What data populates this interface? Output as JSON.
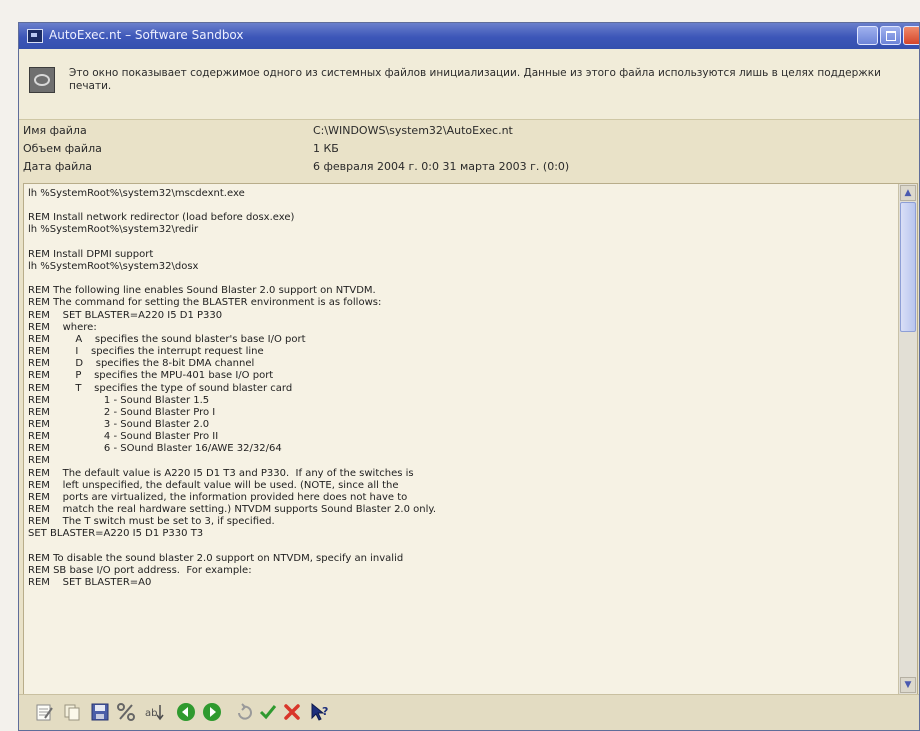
{
  "window": {
    "title": "AutoExec.nt – Software Sandbox"
  },
  "info": {
    "description": "Это окно показывает содержимое одного из системных файлов инициализации. Данные из этого файла используются лишь в целях поддержки печати."
  },
  "properties": [
    {
      "name": "Имя файла",
      "value": "C:\\WINDOWS\\system32\\AutoExec.nt"
    },
    {
      "name": "Объем файла",
      "value": "1 КБ"
    },
    {
      "name": "Дата файла",
      "value": "6 февраля 2004 г. 0:0 31 марта 2003 г. (0:0)"
    }
  ],
  "content": {
    "text": "lh %SystemRoot%\\system32\\mscdexnt.exe\n\nREM Install network redirector (load before dosx.exe)\nlh %SystemRoot%\\system32\\redir\n\nREM Install DPMI support\nlh %SystemRoot%\\system32\\dosx\n\nREM The following line enables Sound Blaster 2.0 support on NTVDM.\nREM The command for setting the BLASTER environment is as follows:\nREM    SET BLASTER=A220 I5 D1 P330\nREM    where:\nREM        A    specifies the sound blaster's base I/O port\nREM        I    specifies the interrupt request line\nREM        D    specifies the 8-bit DMA channel\nREM        P    specifies the MPU-401 base I/O port\nREM        T    specifies the type of sound blaster card\nREM                 1 - Sound Blaster 1.5\nREM                 2 - Sound Blaster Pro I\nREM                 3 - Sound Blaster 2.0\nREM                 4 - Sound Blaster Pro II\nREM                 6 - SOund Blaster 16/AWE 32/32/64\nREM\nREM    The default value is A220 I5 D1 T3 and P330.  If any of the switches is\nREM    left unspecified, the default value will be used. (NOTE, since all the\nREM    ports are virtualized, the information provided here does not have to\nREM    match the real hardware setting.) NTVDM supports Sound Blaster 2.0 only.\nREM    The T switch must be set to 3, if specified.\nSET BLASTER=A220 I5 D1 P330 T3\n\nREM To disable the sound blaster 2.0 support on NTVDM, specify an invalid\nREM SB base I/O port address.  For example:\nREM    SET BLASTER=A0"
  },
  "toolbar": {
    "icons": [
      "notepad-icon",
      "copy-icon",
      "save-icon",
      "percent-icon",
      "sort-icon",
      "back-icon",
      "forward-icon",
      "refresh-icon",
      "check-icon",
      "delete-icon",
      "help-icon"
    ]
  },
  "colors": {
    "titlebar": "#3c56b8",
    "window_bg": "#e9e2c8",
    "content_bg": "#f6f2e4",
    "green": "#2f9a2f",
    "red": "#d9362a"
  }
}
